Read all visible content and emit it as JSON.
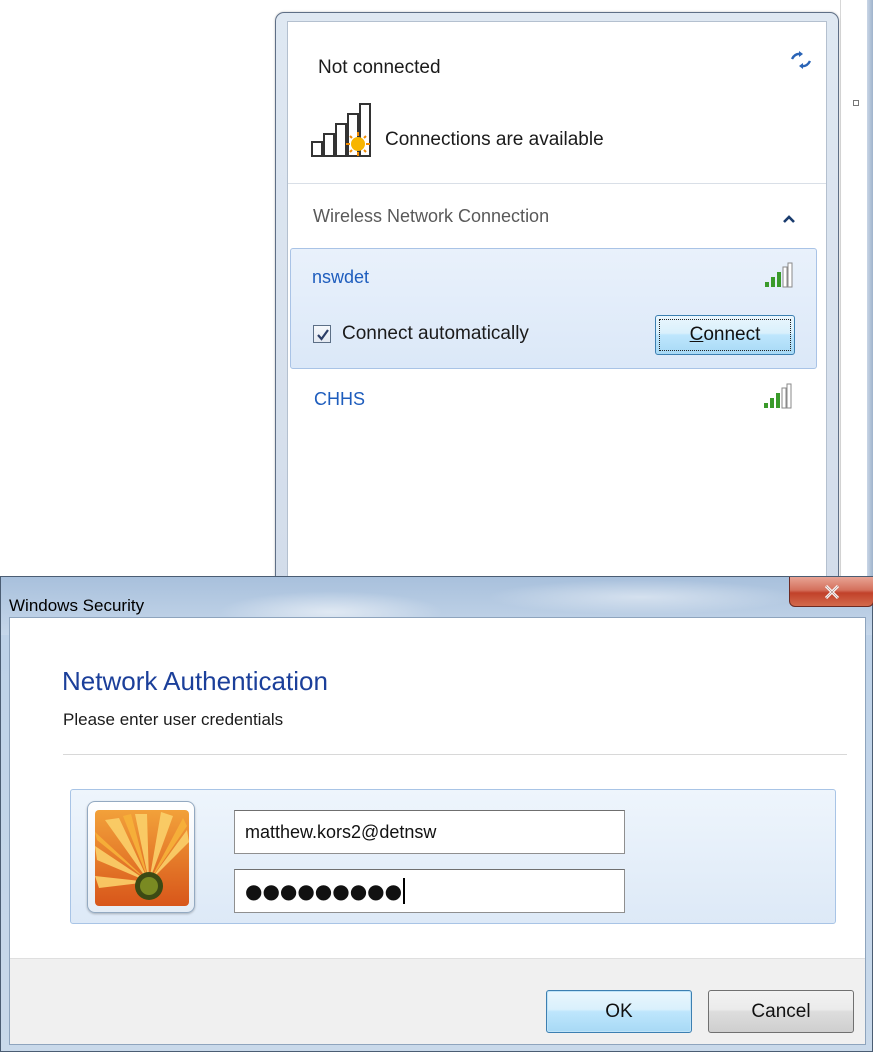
{
  "flyout": {
    "status_title": "Not connected",
    "status_subtitle": "Connections are available",
    "section_title": "Wireless Network Connection",
    "networks": [
      {
        "name": "nswdet",
        "selected": true,
        "connect_automatically_label": "Connect automatically",
        "connect_automatically_checked": true,
        "connect_button_label": "Connect",
        "connect_button_underlined": "C",
        "connect_button_rest": "onnect",
        "signal": "strong"
      },
      {
        "name": "CHHS",
        "selected": false,
        "signal": "strong"
      }
    ]
  },
  "dialog": {
    "window_title": "Windows Security",
    "close_icon": "close-icon",
    "heading": "Network Authentication",
    "subheading": "Please enter user credentials",
    "username_value": "matthew.kors2@detnsw",
    "password_mask": "●●●●●●●●●",
    "ok_label": "OK",
    "cancel_label": "Cancel"
  },
  "colors": {
    "link_blue": "#1e5dbd",
    "heading_blue": "#1b3f9a",
    "signal_green": "#3a9a2a",
    "close_red": "#c1412a"
  }
}
